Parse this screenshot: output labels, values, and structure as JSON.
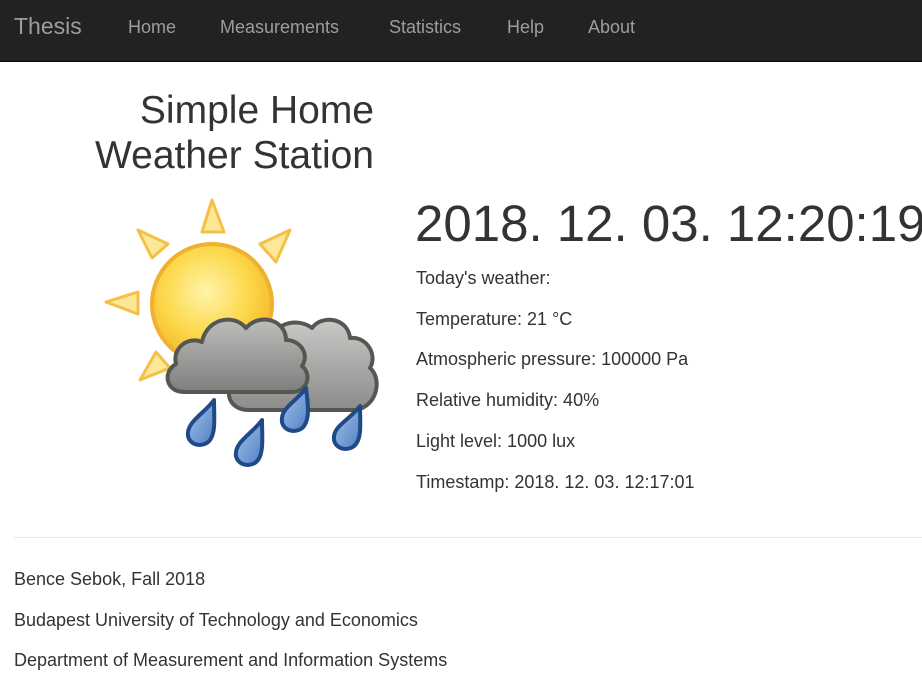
{
  "navbar": {
    "brand": "Thesis",
    "items": [
      {
        "label": "Home"
      },
      {
        "label": "Measurements"
      },
      {
        "label": "Statistics"
      },
      {
        "label": "Help"
      },
      {
        "label": "About"
      }
    ]
  },
  "header": {
    "title_line1": "Simple Home",
    "title_line2": "Weather Station"
  },
  "weather_icon": "sun-cloud-rain-icon",
  "current": {
    "datetime": "2018. 12. 03. 12:20:19",
    "todays_weather_label": "Today's weather:",
    "temperature": "Temperature: 21 °C",
    "pressure": "Atmospheric pressure: 100000 Pa",
    "humidity": "Relative humidity: 40%",
    "light": "Light level: 1000 lux",
    "timestamp": "Timestamp: 2018. 12. 03. 12:17:01"
  },
  "footer": {
    "author": "Bence Sebok, Fall 2018",
    "university": "Budapest University of Technology and Economics",
    "department": "Department of Measurement and Information Systems"
  },
  "colors": {
    "navbar_bg": "#222222",
    "nav_text": "#9d9d9d",
    "text": "#333333"
  }
}
